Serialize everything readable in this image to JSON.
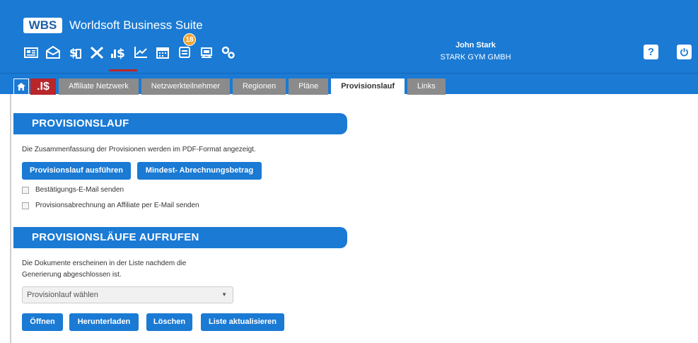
{
  "app": {
    "logo": "WBS",
    "title": "Worldsoft Business Suite"
  },
  "toolbar": {
    "icons": [
      "contact-card-icon",
      "mail-icon",
      "finance-icon",
      "tools-icon",
      "provision-icon",
      "chart-icon",
      "calendar-icon",
      "messages-icon",
      "shop-icon",
      "settings-icon"
    ],
    "messages_badge": "18"
  },
  "user": {
    "name": "John Stark",
    "company": "STARK GYM GMBH"
  },
  "header_buttons": {
    "help": "?"
  },
  "tabs": [
    {
      "label": "Affiliate Netzwerk"
    },
    {
      "label": "Netzwerkteilnehmer"
    },
    {
      "label": "Regionen"
    },
    {
      "label": "Pläne"
    },
    {
      "label": "Provisionslauf",
      "active": true
    },
    {
      "label": "Links"
    }
  ],
  "tab_money_label": ".I$",
  "section1": {
    "title": "PROVISIONSLAUF",
    "description": "Die Zusammenfassung der Provisionen werden im PDF-Format angezeigt.",
    "run_button": "Provisionslauf ausführen",
    "min_button": "Mindest- Abrechnungsbetrag",
    "checkbox1": "Bestätigungs-E-Mail senden",
    "checkbox2": "Provisionsabrechnung an Affiliate per E-Mail senden"
  },
  "section2": {
    "title": "PROVISIONSLÄUFE AUFRUFEN",
    "description_line1": "Die Dokumente erscheinen in der Liste nachdem die",
    "description_line2": "Generierung abgeschlossen ist.",
    "select_value": "Provisionlauf wählen",
    "buttons": {
      "open": "Öffnen",
      "download": "Herunterladen",
      "delete": "Löschen",
      "refresh": "Liste aktualisieren"
    }
  },
  "colors": {
    "primary": "#1a7ad4",
    "accent": "#b8262a",
    "tab_inactive": "#8b8b8b",
    "badge": "#f0a531"
  }
}
